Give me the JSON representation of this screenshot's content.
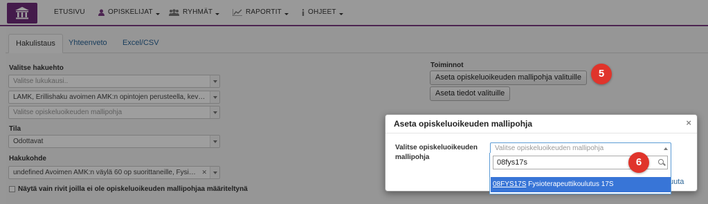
{
  "nav": {
    "items": [
      {
        "label": "ETUSIVU",
        "icon": "none"
      },
      {
        "label": "OPISKELIJAT",
        "icon": "user-icon"
      },
      {
        "label": "RYHMÄT",
        "icon": "group-icon"
      },
      {
        "label": "RAPORTIT",
        "icon": "chart-icon"
      },
      {
        "label": "OHJEET",
        "icon": "info-icon"
      }
    ]
  },
  "tabs": [
    {
      "label": "Hakulistaus"
    },
    {
      "label": "Yhteenveto"
    },
    {
      "label": "Excel/CSV"
    }
  ],
  "filters": {
    "hakuehto_label": "Valitse hakuehto",
    "lukukausi_placeholder": "Valitse lukukausi..",
    "haku_value": "LAMK, Erillishaku avoimen AMK:n opintojen perusteella, kev…",
    "mallipohja_placeholder": "Valitse opiskeluoikeuden mallipohja",
    "tila_label": "Tila",
    "tila_value": "Odottavat",
    "hakukohde_label": "Hakukohde",
    "hakukohde_value": "undefined Avoimen AMK:n väylä 60 op suorittaneille, Fysi…",
    "checkbox_label": "Näytä vain rivit joilla ei ole opiskeluoikeuden mallipohjaa määriteltynä"
  },
  "toiminnot": {
    "label": "Toiminnot",
    "button1": "Aseta opiskeluoikeuden mallipohja valituille",
    "button2": "Aseta tiedot valituille"
  },
  "badges": {
    "first": "5",
    "second": "6"
  },
  "modal": {
    "title": "Aseta opiskeluoikeuden mallipohja",
    "close": "×",
    "field_label": "Valitse opiskeluoikeuden mallipohja",
    "select_placeholder": "Valitse opiskeluoikeuden mallipohja",
    "search_value": "08fys17s",
    "option_code": "08FYS17S",
    "option_name": "Fysioterapeuttikoulutus 17S",
    "footer_link": "uuta"
  },
  "colors": {
    "brand": "#6f2c7a",
    "accent": "#3875d7",
    "badge": "#e0342b"
  }
}
